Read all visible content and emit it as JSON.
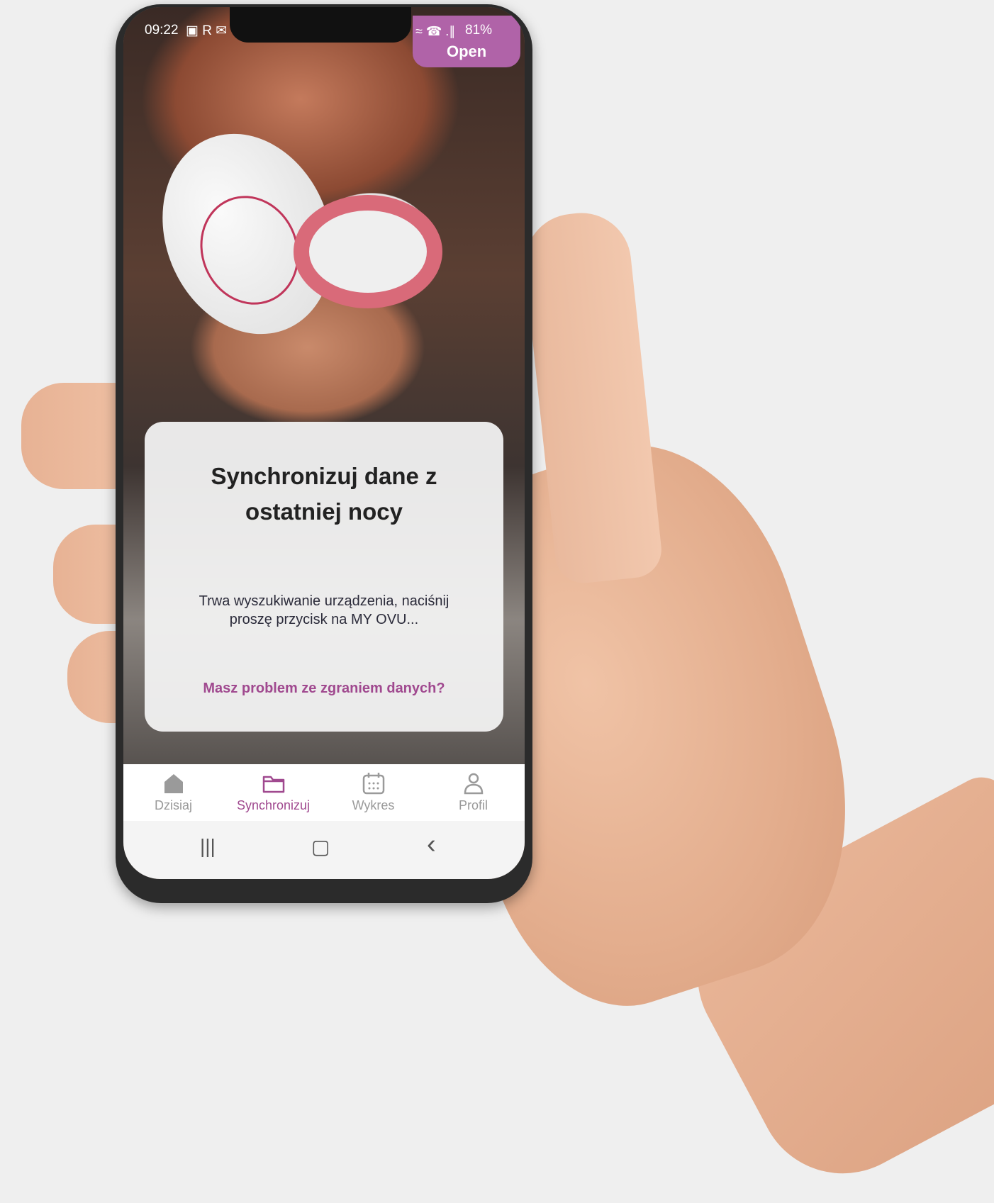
{
  "status_bar": {
    "time": "09:22",
    "left_icons": "▣ R ✉",
    "right_icons": "≈ ☎ .∥",
    "battery": "81%"
  },
  "badge": {
    "label": "Open"
  },
  "sync_card": {
    "title_line1": "Synchronizuj dane z",
    "title_line2": "ostatniej nocy",
    "message_line1": "Trwa wyszukiwanie urządzenia, naciśnij",
    "message_line2": "proszę przycisk na MY OVU...",
    "help_link": "Masz problem ze zgraniem danych?"
  },
  "tabs": [
    {
      "label": "Dzisiaj",
      "icon": "home-icon",
      "active": false
    },
    {
      "label": "Synchronizuj",
      "icon": "folder-icon",
      "active": true
    },
    {
      "label": "Wykres",
      "icon": "calendar-icon",
      "active": false
    },
    {
      "label": "Profil",
      "icon": "user-icon",
      "active": false
    }
  ],
  "system_nav": {
    "recents": "|||",
    "home": "▢",
    "back": "‹"
  },
  "colors": {
    "accent": "#a0498f",
    "badge": "#b063a8"
  }
}
